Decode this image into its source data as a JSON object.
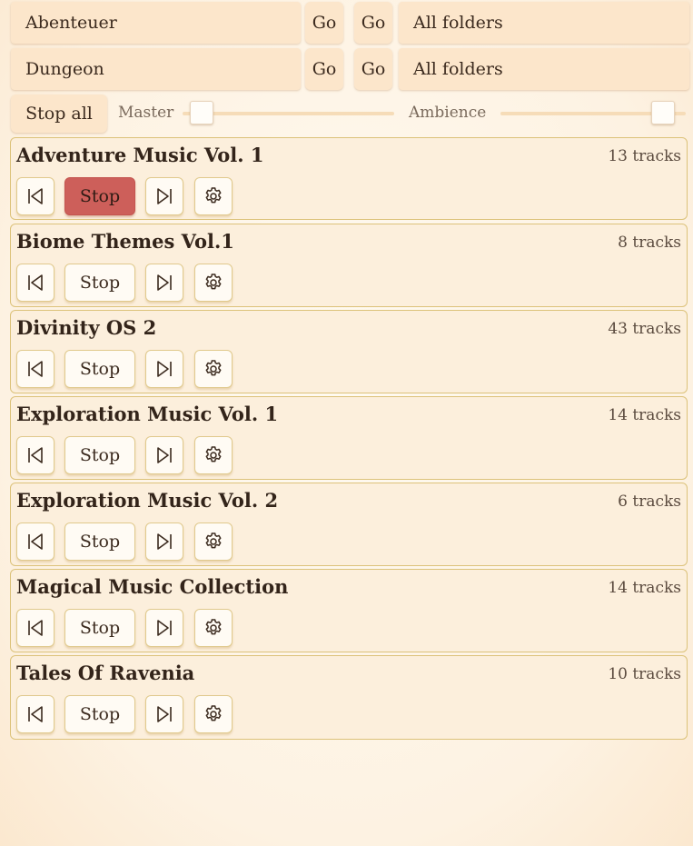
{
  "scenes": [
    {
      "name": "Abenteuer",
      "go1": "Go",
      "go2": "Go",
      "folder": "All folders"
    },
    {
      "name": "Dungeon",
      "go1": "Go",
      "go2": "Go",
      "folder": "All folders"
    }
  ],
  "controls": {
    "stop_all": "Stop all",
    "master_label": "Master",
    "master_level": 0.04,
    "ambience_label": "Ambience",
    "ambience_level": 0.93
  },
  "playlists": [
    {
      "title": "Adventure Music Vol. 1",
      "count": "13 tracks",
      "stop": "Stop",
      "playing": true
    },
    {
      "title": "Biome Themes Vol.1",
      "count": "8 tracks",
      "stop": "Stop",
      "playing": false
    },
    {
      "title": "Divinity OS 2",
      "count": "43 tracks",
      "stop": "Stop",
      "playing": false
    },
    {
      "title": "Exploration Music Vol. 1",
      "count": "14 tracks",
      "stop": "Stop",
      "playing": false
    },
    {
      "title": "Exploration Music Vol. 2",
      "count": "6 tracks",
      "stop": "Stop",
      "playing": false
    },
    {
      "title": "Magical Music Collection",
      "count": "14 tracks",
      "stop": "Stop",
      "playing": false
    },
    {
      "title": "Tales Of Ravenia",
      "count": "10 tracks",
      "stop": "Stop",
      "playing": false
    }
  ],
  "icons": {
    "prev": "skip-previous-icon",
    "next": "skip-next-icon",
    "settings": "gear-icon"
  },
  "colors": {
    "active_stop": "#cd5f5a",
    "card_border": "#dcc27a",
    "field_bg": "#fce6cb"
  }
}
